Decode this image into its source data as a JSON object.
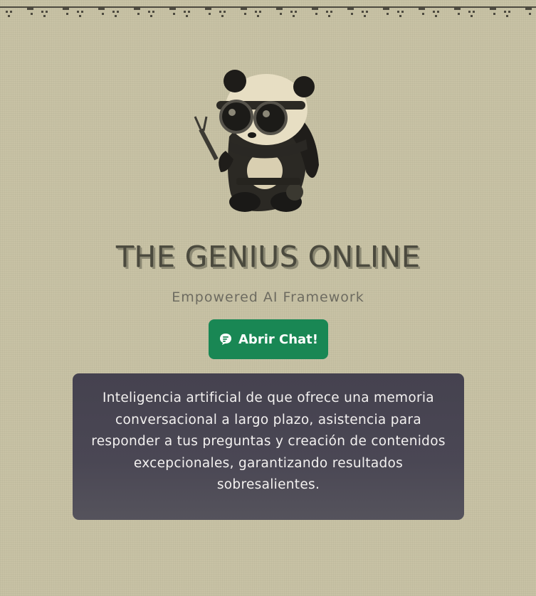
{
  "site": {
    "title": "THE GENIUS ONLINE",
    "subtitle": "Empowered AI Framework"
  },
  "chat_button": {
    "label": "Abrir Chat!",
    "icon": "chat-icon",
    "color": "#198754"
  },
  "description": {
    "text": "Inteligencia artificial de que ofrece una memoria conversacional a largo plazo, asistencia para responder a tus preguntas y creación de contenidos excepcionales, garantizando resultados sobresalientes."
  },
  "mascot": {
    "icon": "panda-mascot-icon"
  },
  "colors": {
    "background": "#c8c2a5",
    "title": "#4b4a3e",
    "panel": "#46434f"
  }
}
